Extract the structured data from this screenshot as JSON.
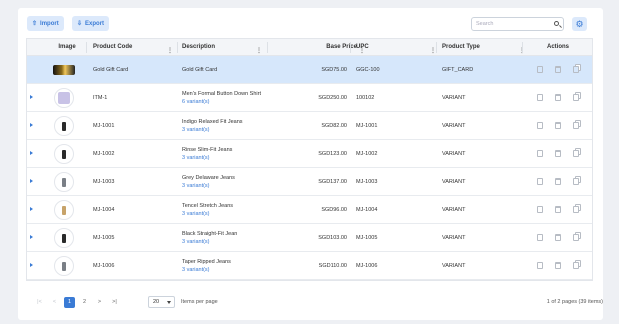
{
  "toolbar": {
    "import_label": "Import",
    "export_label": "Export",
    "search_placeholder": "Search"
  },
  "table": {
    "columns": [
      "Image",
      "Product Code",
      "Description",
      "Base Price",
      "UPC",
      "Product Type",
      "Actions"
    ],
    "rows": [
      {
        "code": "Gold Gift Card",
        "description": "Gold Gift Card",
        "variants": "",
        "price": "SGD75.00",
        "upc": "GGC-100",
        "type": "GIFT_CARD",
        "thumb": "gift-card"
      },
      {
        "code": "ITM-1",
        "description": "Men's Formal Button Down Shirt",
        "variants": "6 variant(s)",
        "price": "SGD250.00",
        "upc": "100102",
        "type": "VARIANT",
        "thumb": "shirt"
      },
      {
        "code": "MJ-1001",
        "description": "Indigo Relaxed Fit Jeans",
        "variants": "3 variant(s)",
        "price": "SGD82.00",
        "upc": "MJ-1001",
        "type": "VARIANT",
        "thumb": "jeans-dark"
      },
      {
        "code": "MJ-1002",
        "description": "Rinse Slim-Fit Jeans",
        "variants": "3 variant(s)",
        "price": "SGD123.00",
        "upc": "MJ-1002",
        "type": "VARIANT",
        "thumb": "jeans-dark"
      },
      {
        "code": "MJ-1003",
        "description": "Grey Delaware Jeans",
        "variants": "3 variant(s)",
        "price": "SGD137.00",
        "upc": "MJ-1003",
        "type": "VARIANT",
        "thumb": "jeans-grey"
      },
      {
        "code": "MJ-1004",
        "description": "Tencel Stretch Jeans",
        "variants": "3 variant(s)",
        "price": "SGD96.00",
        "upc": "MJ-1004",
        "type": "VARIANT",
        "thumb": "jeans-tan"
      },
      {
        "code": "MJ-1005",
        "description": "Black Straight-Fit Jean",
        "variants": "3 variant(s)",
        "price": "SGD103.00",
        "upc": "MJ-1005",
        "type": "VARIANT",
        "thumb": "jeans-dark"
      },
      {
        "code": "MJ-1006",
        "description": "Taper Ripped Jeans",
        "variants": "3 variant(s)",
        "price": "SGD110.00",
        "upc": "MJ-1006",
        "type": "VARIANT",
        "thumb": "jeans-grey"
      }
    ]
  },
  "pagination": {
    "first": "|<",
    "prev": "<",
    "pages": [
      "1",
      "2"
    ],
    "next": ">",
    "last": ">|",
    "items_per_page_value": "20",
    "items_per_page_label": "Items per page",
    "page_info": "1 of 2 pages (39 items)"
  },
  "colors": {
    "accent": "#3a7bd5",
    "selected_row": "#d6e7fb"
  }
}
